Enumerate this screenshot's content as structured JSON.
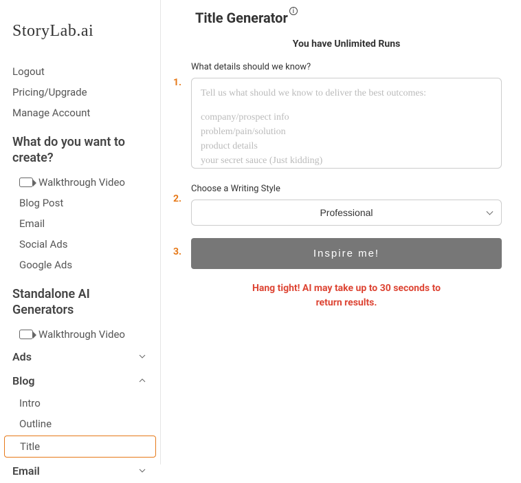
{
  "brand": "StoryLab.ai",
  "sidebar": {
    "account": [
      {
        "label": "Logout"
      },
      {
        "label": "Pricing/Upgrade"
      },
      {
        "label": "Manage Account"
      }
    ],
    "create_heading": "What do you want to create?",
    "create_items": [
      {
        "label": "Walkthrough Video",
        "icon": "video"
      },
      {
        "label": "Blog Post"
      },
      {
        "label": "Email"
      },
      {
        "label": "Social Ads"
      },
      {
        "label": "Google Ads"
      }
    ],
    "standalone_heading": "Standalone AI Generators",
    "standalone_items": [
      {
        "label": "Walkthrough Video",
        "icon": "video"
      }
    ],
    "categories": [
      {
        "label": "Ads",
        "expanded": false
      },
      {
        "label": "Blog",
        "expanded": true,
        "children": [
          {
            "label": "Intro"
          },
          {
            "label": "Outline"
          },
          {
            "label": "Title",
            "active": true
          }
        ]
      },
      {
        "label": "Email",
        "expanded": false
      }
    ]
  },
  "main": {
    "title": "Title Generator",
    "info_glyph": "i",
    "runs_text": "You have Unlimited Runs",
    "steps": {
      "1": {
        "num": "1.",
        "label": "What details should we know?",
        "placeholder_lines": [
          "Tell us what should we know to deliver the best outcomes:",
          "",
          "company/prospect info",
          "problem/pain/solution",
          "product details",
          "your secret sauce (Just kidding)"
        ]
      },
      "2": {
        "num": "2.",
        "label": "Choose a Writing Style",
        "selected": "Professional"
      },
      "3": {
        "num": "3.",
        "button": "Inspire me!"
      }
    },
    "wait_line1": "Hang tight! AI may take up to 30 seconds to",
    "wait_line2": "return results."
  }
}
